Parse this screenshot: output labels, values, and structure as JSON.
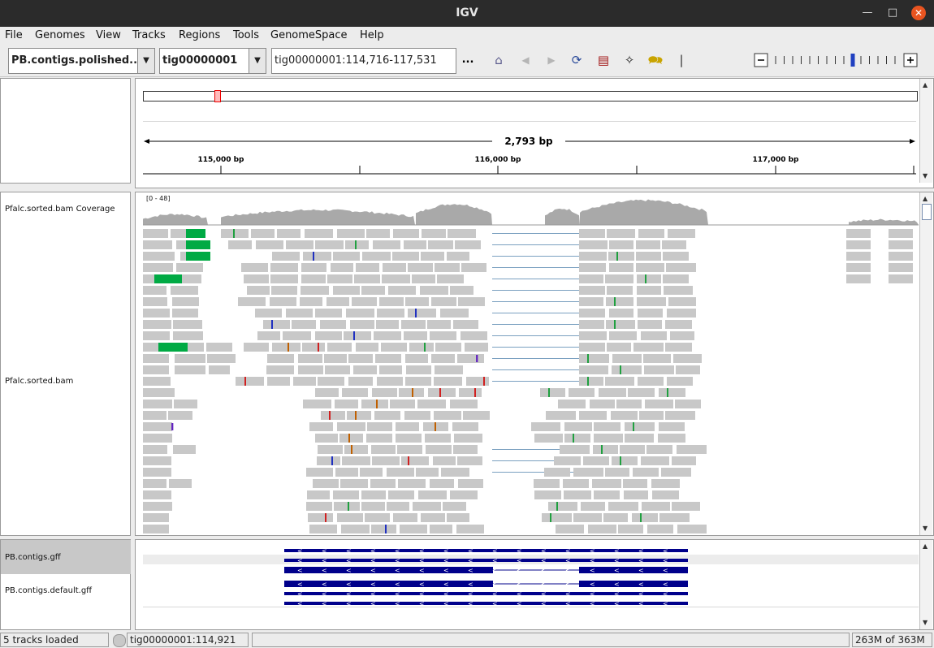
{
  "window": {
    "title": "IGV"
  },
  "menu": [
    "File",
    "Genomes",
    "View",
    "Tracks",
    "Regions",
    "Tools",
    "GenomeSpace",
    "Help"
  ],
  "toolbar": {
    "genome": "PB.contigs.polished...",
    "chromosome": "tig00000001",
    "locus": "tig00000001:114,716-117,531",
    "more": "..."
  },
  "ruler": {
    "span": "2,793 bp",
    "ticks": [
      "115,000 bp",
      "116,000 bp",
      "117,000 bp"
    ]
  },
  "tracks": {
    "coverage": {
      "name": "Pfalc.sorted.bam Coverage",
      "range": "[0 - 48]"
    },
    "alignments": {
      "name": "Pfalc.sorted.bam"
    },
    "gff": {
      "name": "PB.contigs.gff"
    },
    "default_gff": {
      "name": "PB.contigs.default.gff"
    }
  },
  "status": {
    "tracks_loaded": "5 tracks loaded",
    "position": "tig00000001:114,921",
    "memory": "263M of 363M"
  },
  "colors": {
    "feature": "#00008b",
    "read": "#c8c8c8",
    "coverage": "#a9a9a9",
    "soft_clip": "#00aa44",
    "selection": "#c8c8c8",
    "close": "#e95420"
  }
}
